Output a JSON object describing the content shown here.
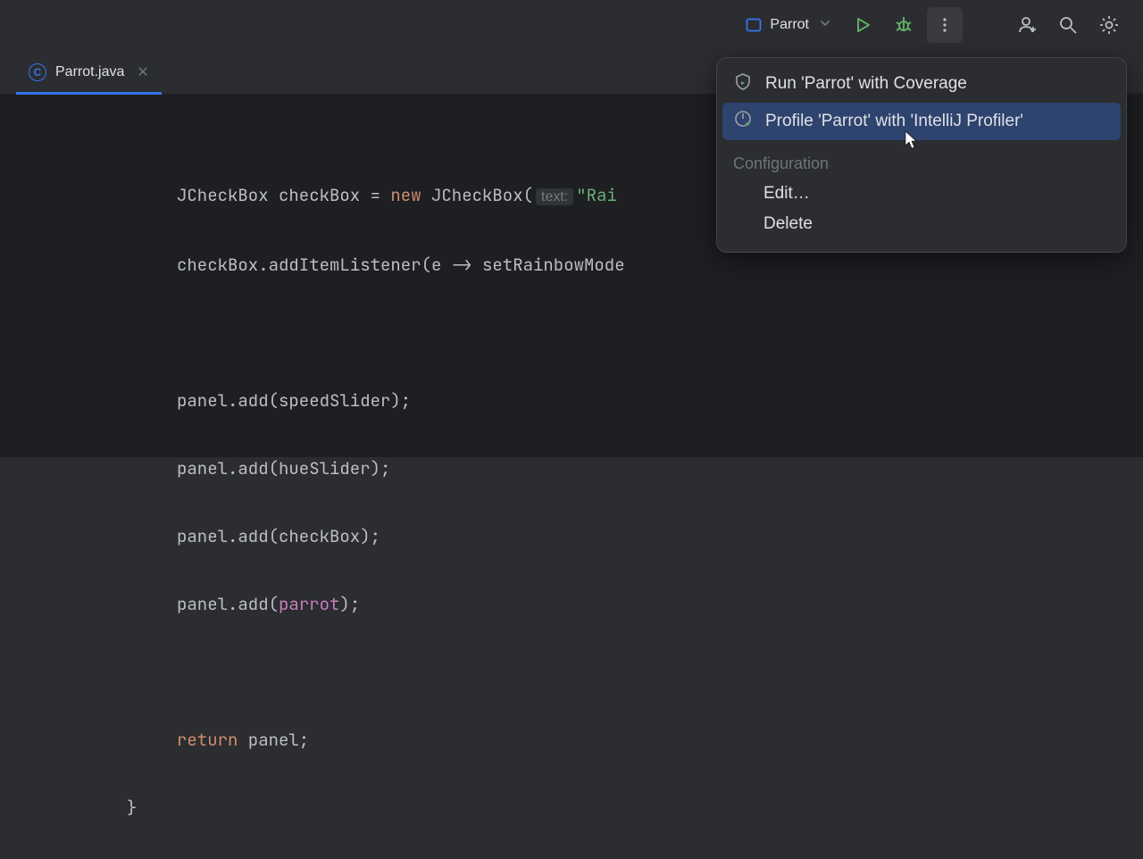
{
  "toolbar": {
    "run_config_name": "Parrot"
  },
  "tab": {
    "filename": "Parrot.java",
    "icon_letter": "C"
  },
  "code": {
    "l1a": "JCheckBox checkBox = ",
    "l1_new": "new",
    "l1b": " JCheckBox(",
    "l1_hint": "text:",
    "l1_str": "\"Rai",
    "l2a": "checkBox.addItemListener(e -> setRainbowMode",
    "l3": "panel.add(speedSlider);",
    "l4": "panel.add(hueSlider);",
    "l5": "panel.add(checkBox);",
    "l6a": "panel.add(",
    "l6_id": "parrot",
    "l6b": ");",
    "l7_kw": "return",
    "l7_rest": " panel;",
    "l8": "}"
  },
  "popup": {
    "coverage": "Run 'Parrot' with Coverage",
    "profile": "Profile 'Parrot' with 'IntelliJ Profiler'",
    "config_header": "Configuration",
    "edit": "Edit…",
    "delete": "Delete"
  }
}
